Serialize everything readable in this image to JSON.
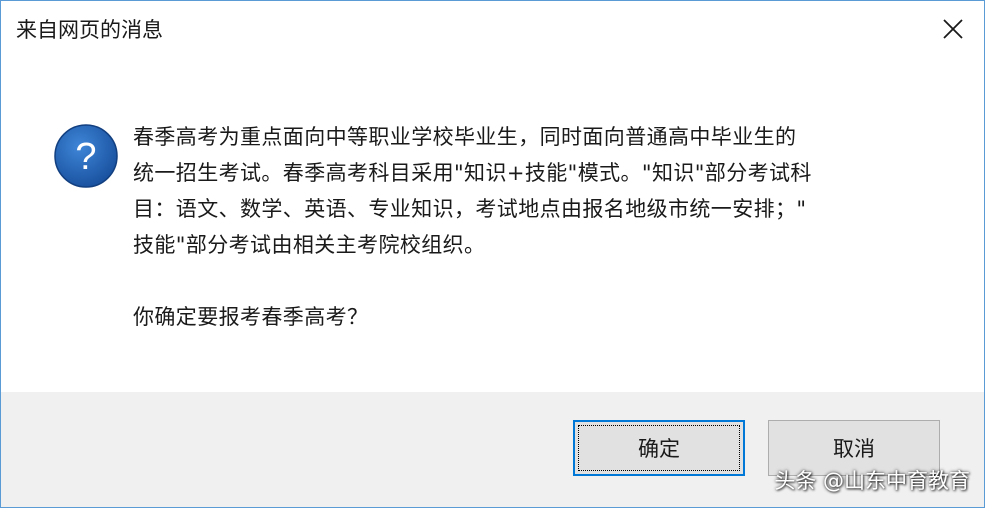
{
  "window": {
    "title": "来自网页的消息",
    "close_icon": "close-icon"
  },
  "message": {
    "icon": "question-icon",
    "icon_color": "#1e5aa8",
    "lines": [
      "春季高考为重点面向中等职业学校毕业生，同时面向普通高中毕业生的",
      "统一招生考试。春季高考科目采用\"知识+技能\"模式。\"知识\"部分考试科",
      "目：语文、数学、英语、专业知识，考试地点由报名地级市统一安排；\"",
      "技能\"部分考试由相关主考院校组织。"
    ],
    "question": "你确定要报考春季高考？"
  },
  "buttons": {
    "ok_label": "确定",
    "cancel_label": "取消"
  },
  "watermark": {
    "text": "头条 @山东中育教育"
  },
  "colors": {
    "border": "#5a9bd5",
    "footer_bg": "#f0f0f0",
    "button_bg": "#e1e1e1",
    "focus_border": "#0078d7"
  }
}
